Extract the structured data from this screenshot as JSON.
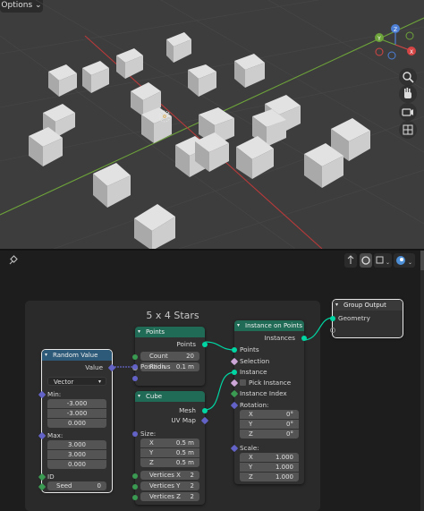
{
  "viewport": {
    "options_label": "Options",
    "gizmo": {
      "x_label": "X",
      "y_label": "Y",
      "z_label": "Z"
    },
    "colors": {
      "background": "#3d3d3d",
      "axis_x": "#b83a3a",
      "axis_y": "#6da33a",
      "cube_face": "#d6d6d6",
      "cube_side": "#a8a8a8"
    }
  },
  "frame": {
    "label": "5 x 4 Stars"
  },
  "nodes": {
    "points": {
      "title": "Points",
      "out_points": "Points",
      "count_label": "Count",
      "count_value": "20",
      "radius_label": "Radius",
      "radius_value": "0.1 m"
    },
    "random_value": {
      "title": "Random Value",
      "out_value": "Value",
      "type_value": "Vector",
      "min_label": "Min:",
      "min_values": [
        "-3.000",
        "-3.000",
        "0.000"
      ],
      "max_label": "Max:",
      "max_values": [
        "3.000",
        "3.000",
        "0.000"
      ],
      "id_label": "ID",
      "seed_label": "Seed",
      "seed_value": "0"
    },
    "position": {
      "label": "Position"
    },
    "cube": {
      "title": "Cube",
      "out_mesh": "Mesh",
      "out_uvmap": "UV Map",
      "size_label": "Size:",
      "size_rows": [
        {
          "axis": "X",
          "value": "0.5 m"
        },
        {
          "axis": "Y",
          "value": "0.5 m"
        },
        {
          "axis": "Z",
          "value": "0.5 m"
        }
      ],
      "vertices": [
        {
          "label": "Vertices X",
          "value": "2"
        },
        {
          "label": "Vertices Y",
          "value": "2"
        },
        {
          "label": "Vertices Z",
          "value": "2"
        }
      ]
    },
    "instance_on_points": {
      "title": "Instance on Points",
      "out_instances": "Instances",
      "in_points": "Points",
      "in_selection": "Selection",
      "in_instance": "Instance",
      "pick_instance": "Pick Instance",
      "instance_index": "Instance Index",
      "rotation_label": "Rotation:",
      "rotation_rows": [
        {
          "axis": "X",
          "value": "0°"
        },
        {
          "axis": "Y",
          "value": "0°"
        },
        {
          "axis": "Z",
          "value": "0°"
        }
      ],
      "scale_label": "Scale:",
      "scale_rows": [
        {
          "axis": "X",
          "value": "1.000"
        },
        {
          "axis": "Y",
          "value": "1.000"
        },
        {
          "axis": "Z",
          "value": "1.000"
        }
      ]
    },
    "group_output": {
      "title": "Group Output",
      "in_geometry": "Geometry"
    }
  },
  "socket_colors": {
    "geometry": "#00d6a3",
    "vector": "#6363c7",
    "float": "#a1a1a1",
    "integer": "#3a9a52",
    "boolean": "#cca6d6"
  }
}
